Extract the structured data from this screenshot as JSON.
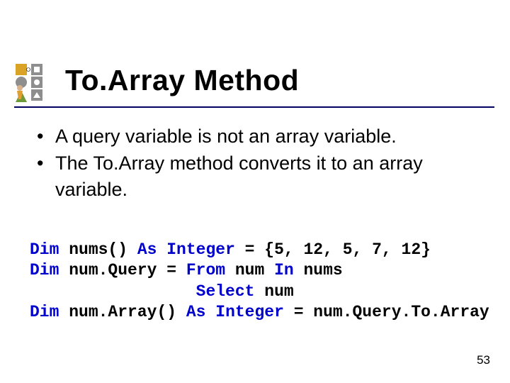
{
  "title": "To.Array Method",
  "bullets": [
    "A query variable is not an array variable.",
    "The To.Array method converts it to an array variable."
  ],
  "code": {
    "line1": {
      "t1": "Dim",
      "t2": " nums() ",
      "t3": "As Integer",
      "t4": " = {5, 12, 5, 7, 12}"
    },
    "line2": {
      "t1": "Dim",
      "t2": " num.Query = ",
      "t3": "From",
      "t4": " num ",
      "t5": "In",
      "t6": " nums"
    },
    "line3": {
      "indent": "                 ",
      "t1": "Select",
      "t2": " num"
    },
    "line4": {
      "t1": "Dim",
      "t2": " num.Array() ",
      "t3": "As Integer",
      "t4": " = num.Query.To.Array"
    }
  },
  "page_number": "53"
}
